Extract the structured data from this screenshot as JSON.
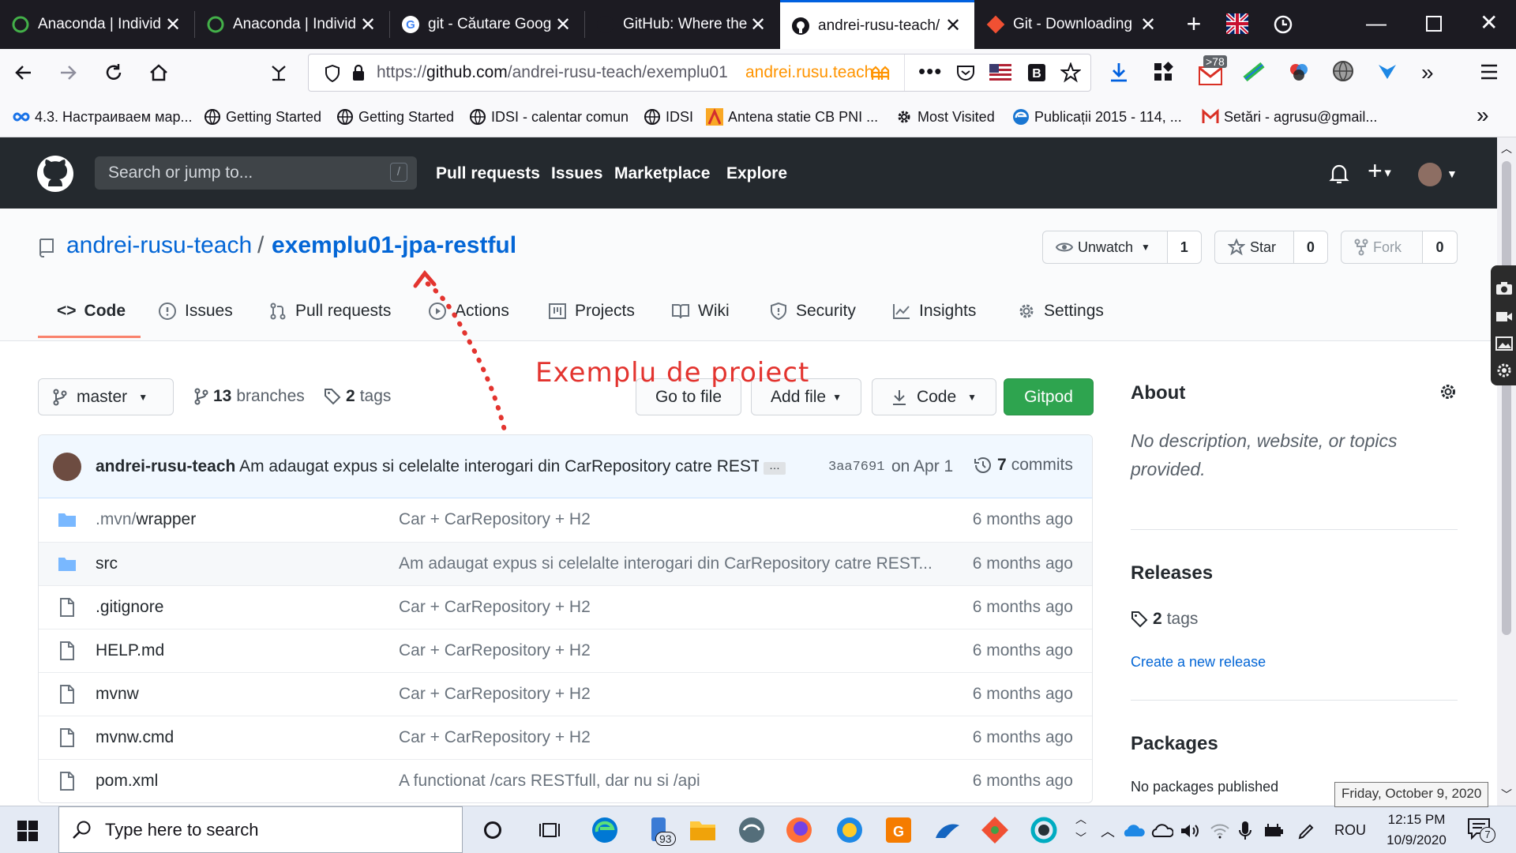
{
  "browser": {
    "tabs": [
      {
        "label": "Anaconda | Individ",
        "icon": "anaconda-icon",
        "active": false
      },
      {
        "label": "Anaconda | Individ",
        "icon": "anaconda-icon",
        "active": false
      },
      {
        "label": "git - Căutare Goog",
        "icon": "google-icon",
        "active": false
      },
      {
        "label": "GitHub: Where the",
        "icon": "github-icon",
        "active": false
      },
      {
        "label": "andrei-rusu-teach/",
        "icon": "github-icon",
        "active": true
      },
      {
        "label": "Git - Downloading",
        "icon": "git-icon",
        "active": false
      }
    ],
    "url_prefix": "https://",
    "url_host": "github.com",
    "url_path": "/andrei-rusu-teach/exemplu01",
    "container_label": "andrei.rusu.teach",
    "extension_badge": ">78",
    "accent_color": "#0060df"
  },
  "bookmarks": [
    "4.3. Настраиваем мар...",
    "Getting Started",
    "Getting Started",
    "IDSI - calentar comun",
    "IDSI",
    "Antena statie CB PNI ...",
    "Most Visited",
    "Publicații 2015 - 114, ...",
    "Setări - agrusu@gmail..."
  ],
  "github": {
    "search_placeholder": "Search or jump to...",
    "search_shortcut": "/",
    "nav": [
      "Pull requests",
      "Issues",
      "Marketplace",
      "Explore"
    ],
    "owner": "andrei-rusu-teach",
    "repo_sep": "/",
    "repo": "exemplu01-jpa-restful",
    "unwatch_label": "Unwatch",
    "watch_count": "1",
    "star_label": "Star",
    "star_count": "0",
    "fork_label": "Fork",
    "fork_count": "0",
    "tabs": [
      "Code",
      "Issues",
      "Pull requests",
      "Actions",
      "Projects",
      "Wiki",
      "Security",
      "Insights",
      "Settings"
    ],
    "branch": "master",
    "branches_count": "13",
    "branches_label": "branches",
    "tags_count": "2",
    "tags_label": "tags",
    "go_to_file": "Go to file",
    "add_file": "Add file",
    "code_btn": "Code",
    "gitpod_btn": "Gitpod",
    "gitpod_color": "#2ea44f",
    "annotation": "Exemplu de proiect",
    "annotation_color": "#e3342f",
    "commit": {
      "author": "andrei-rusu-teach",
      "message": "Am adaugat expus si celelalte interogari din CarRepository catre REST...",
      "ellipsis": "…",
      "sha": "3aa7691",
      "date": "on Apr 1",
      "commits_count": "7",
      "commits_label": "commits"
    },
    "files": [
      {
        "type": "folder",
        "name_dim": ".mvn/",
        "name": "wrapper",
        "message": "Car + CarRepository + H2",
        "age": "6 months ago"
      },
      {
        "type": "folder",
        "name_dim": "",
        "name": "src",
        "message": "Am adaugat expus si celelalte interogari din CarRepository catre REST...",
        "age": "6 months ago"
      },
      {
        "type": "file",
        "name_dim": "",
        "name": ".gitignore",
        "message": "Car + CarRepository + H2",
        "age": "6 months ago"
      },
      {
        "type": "file",
        "name_dim": "",
        "name": "HELP.md",
        "message": "Car + CarRepository + H2",
        "age": "6 months ago"
      },
      {
        "type": "file",
        "name_dim": "",
        "name": "mvnw",
        "message": "Car + CarRepository + H2",
        "age": "6 months ago"
      },
      {
        "type": "file",
        "name_dim": "",
        "name": "mvnw.cmd",
        "message": "Car + CarRepository + H2",
        "age": "6 months ago"
      },
      {
        "type": "file",
        "name_dim": "",
        "name": "pom.xml",
        "message": "A functionat /cars RESTfull, dar nu si /api",
        "age": "6 months ago"
      }
    ],
    "about": {
      "title": "About",
      "description": "No description, website, or topics provided."
    },
    "releases": {
      "title": "Releases",
      "tags_count": "2",
      "tags_label": "tags",
      "create_link": "Create a new release"
    },
    "packages": {
      "title": "Packages",
      "text": "No packages published"
    }
  },
  "taskbar": {
    "search_placeholder": "Type here to search",
    "badge": "93",
    "language": "ROU",
    "time": "12:15 PM",
    "date": "10/9/2020",
    "tooltip": "Friday, October 9, 2020",
    "notif_count": "7"
  }
}
